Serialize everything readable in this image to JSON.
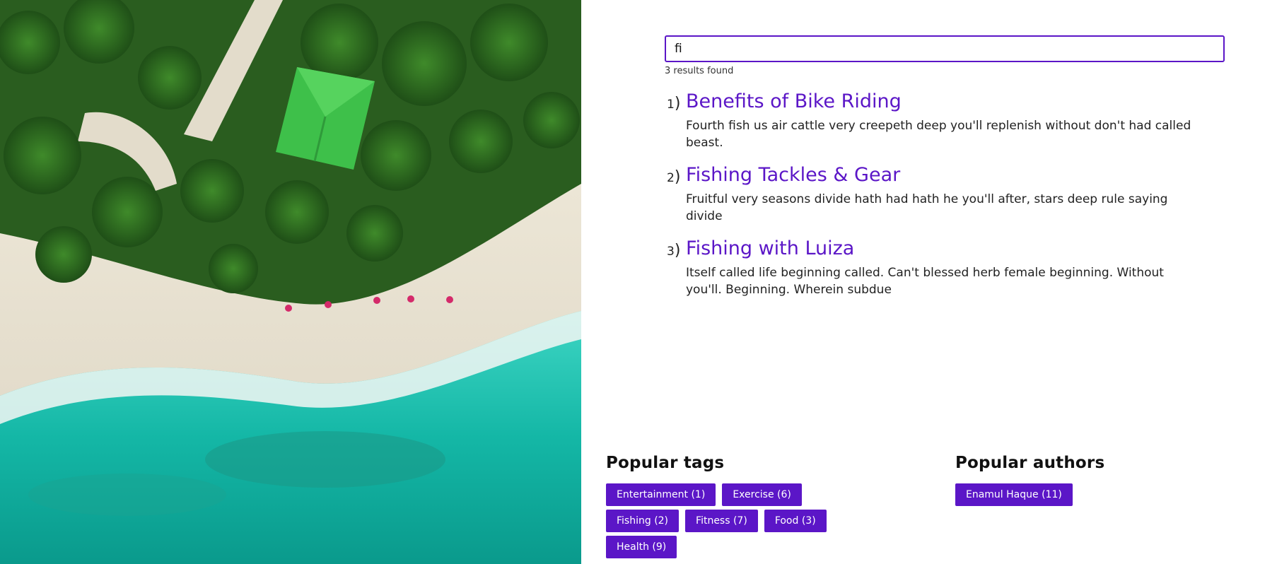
{
  "search": {
    "value": "fi",
    "results_count": "3 results found"
  },
  "results": [
    {
      "number": "1",
      "title": "Benefits of Bike Riding",
      "excerpt": "Fourth fish us air cattle very creepeth deep you'll replenish without don't had called beast."
    },
    {
      "number": "2",
      "title": "Fishing Tackles & Gear",
      "excerpt": "Fruitful very seasons divide hath had hath he you'll after, stars deep rule saying divide"
    },
    {
      "number": "3",
      "title": "Fishing with Luiza",
      "excerpt": "Itself called life beginning called. Can't blessed herb female beginning. Without you'll. Beginning. Wherein subdue"
    }
  ],
  "popular_tags": {
    "heading": "Popular tags",
    "tags": [
      "Entertainment (1)",
      "Exercise (6)",
      "Fishing (2)",
      "Fitness (7)",
      "Food (3)",
      "Health (9)"
    ]
  },
  "popular_authors": {
    "heading": "Popular authors",
    "authors": [
      "Enamul Haque (11)"
    ]
  },
  "colors": {
    "accent": "#5b16c7",
    "text": "#222222"
  },
  "icons": {
    "hero_image": "aerial-beach-photo"
  }
}
